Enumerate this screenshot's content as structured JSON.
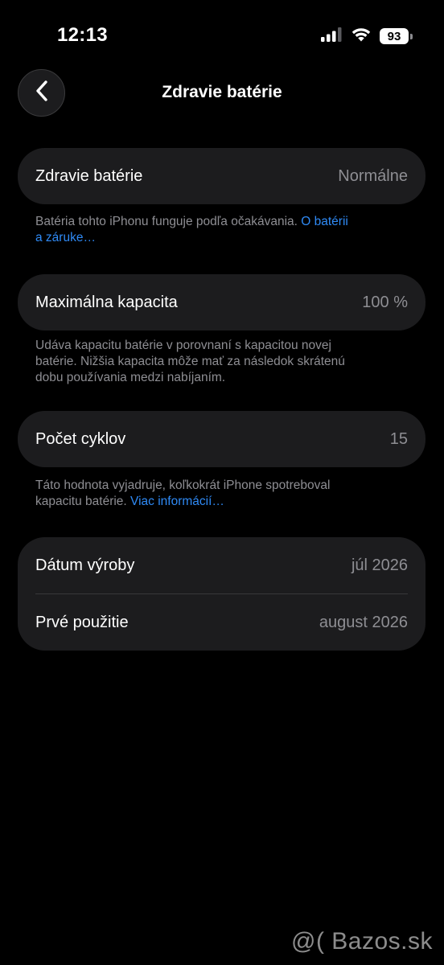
{
  "status_bar": {
    "time": "12:13",
    "battery_level": "93",
    "icons": [
      "cellular-signal-icon",
      "wifi-icon",
      "battery-icon"
    ]
  },
  "nav": {
    "title": "Zdravie batérie",
    "back_icon": "chevron-left-icon"
  },
  "battery_health": {
    "label": "Zdravie batérie",
    "value": "Normálne",
    "footnote_text": "Batéria tohto iPhonu funguje podľa očakávania. ",
    "footnote_link_line1": "O batérii",
    "footnote_link_line2": "a záruke…"
  },
  "max_capacity": {
    "label": "Maximálna kapacita",
    "value": "100 %",
    "footnote_line1": "Udáva kapacitu batérie v porovnaní s kapacitou novej",
    "footnote_line2": "batérie. Nižšia kapacita môže mať za následok skrátenú",
    "footnote_line3": "dobu používania medzi nabíjaním."
  },
  "cycle_count": {
    "label": "Počet cyklov",
    "value": "15",
    "footnote_line1": "Táto hodnota vyjadruje, koľkokrát iPhone spotreboval",
    "footnote_line2_text": "kapacitu batérie. ",
    "footnote_link": "Viac informácií…"
  },
  "dates": {
    "manufacture_label": "Dátum výroby",
    "manufacture_value": "júl 2026",
    "first_use_label": "Prvé použitie",
    "first_use_value": "august 2026"
  },
  "watermark": "@( Bazos.sk",
  "colors": {
    "background": "#000000",
    "card": "#1c1c1e",
    "secondary_text": "#8e8e93",
    "link": "#2f8af5"
  }
}
